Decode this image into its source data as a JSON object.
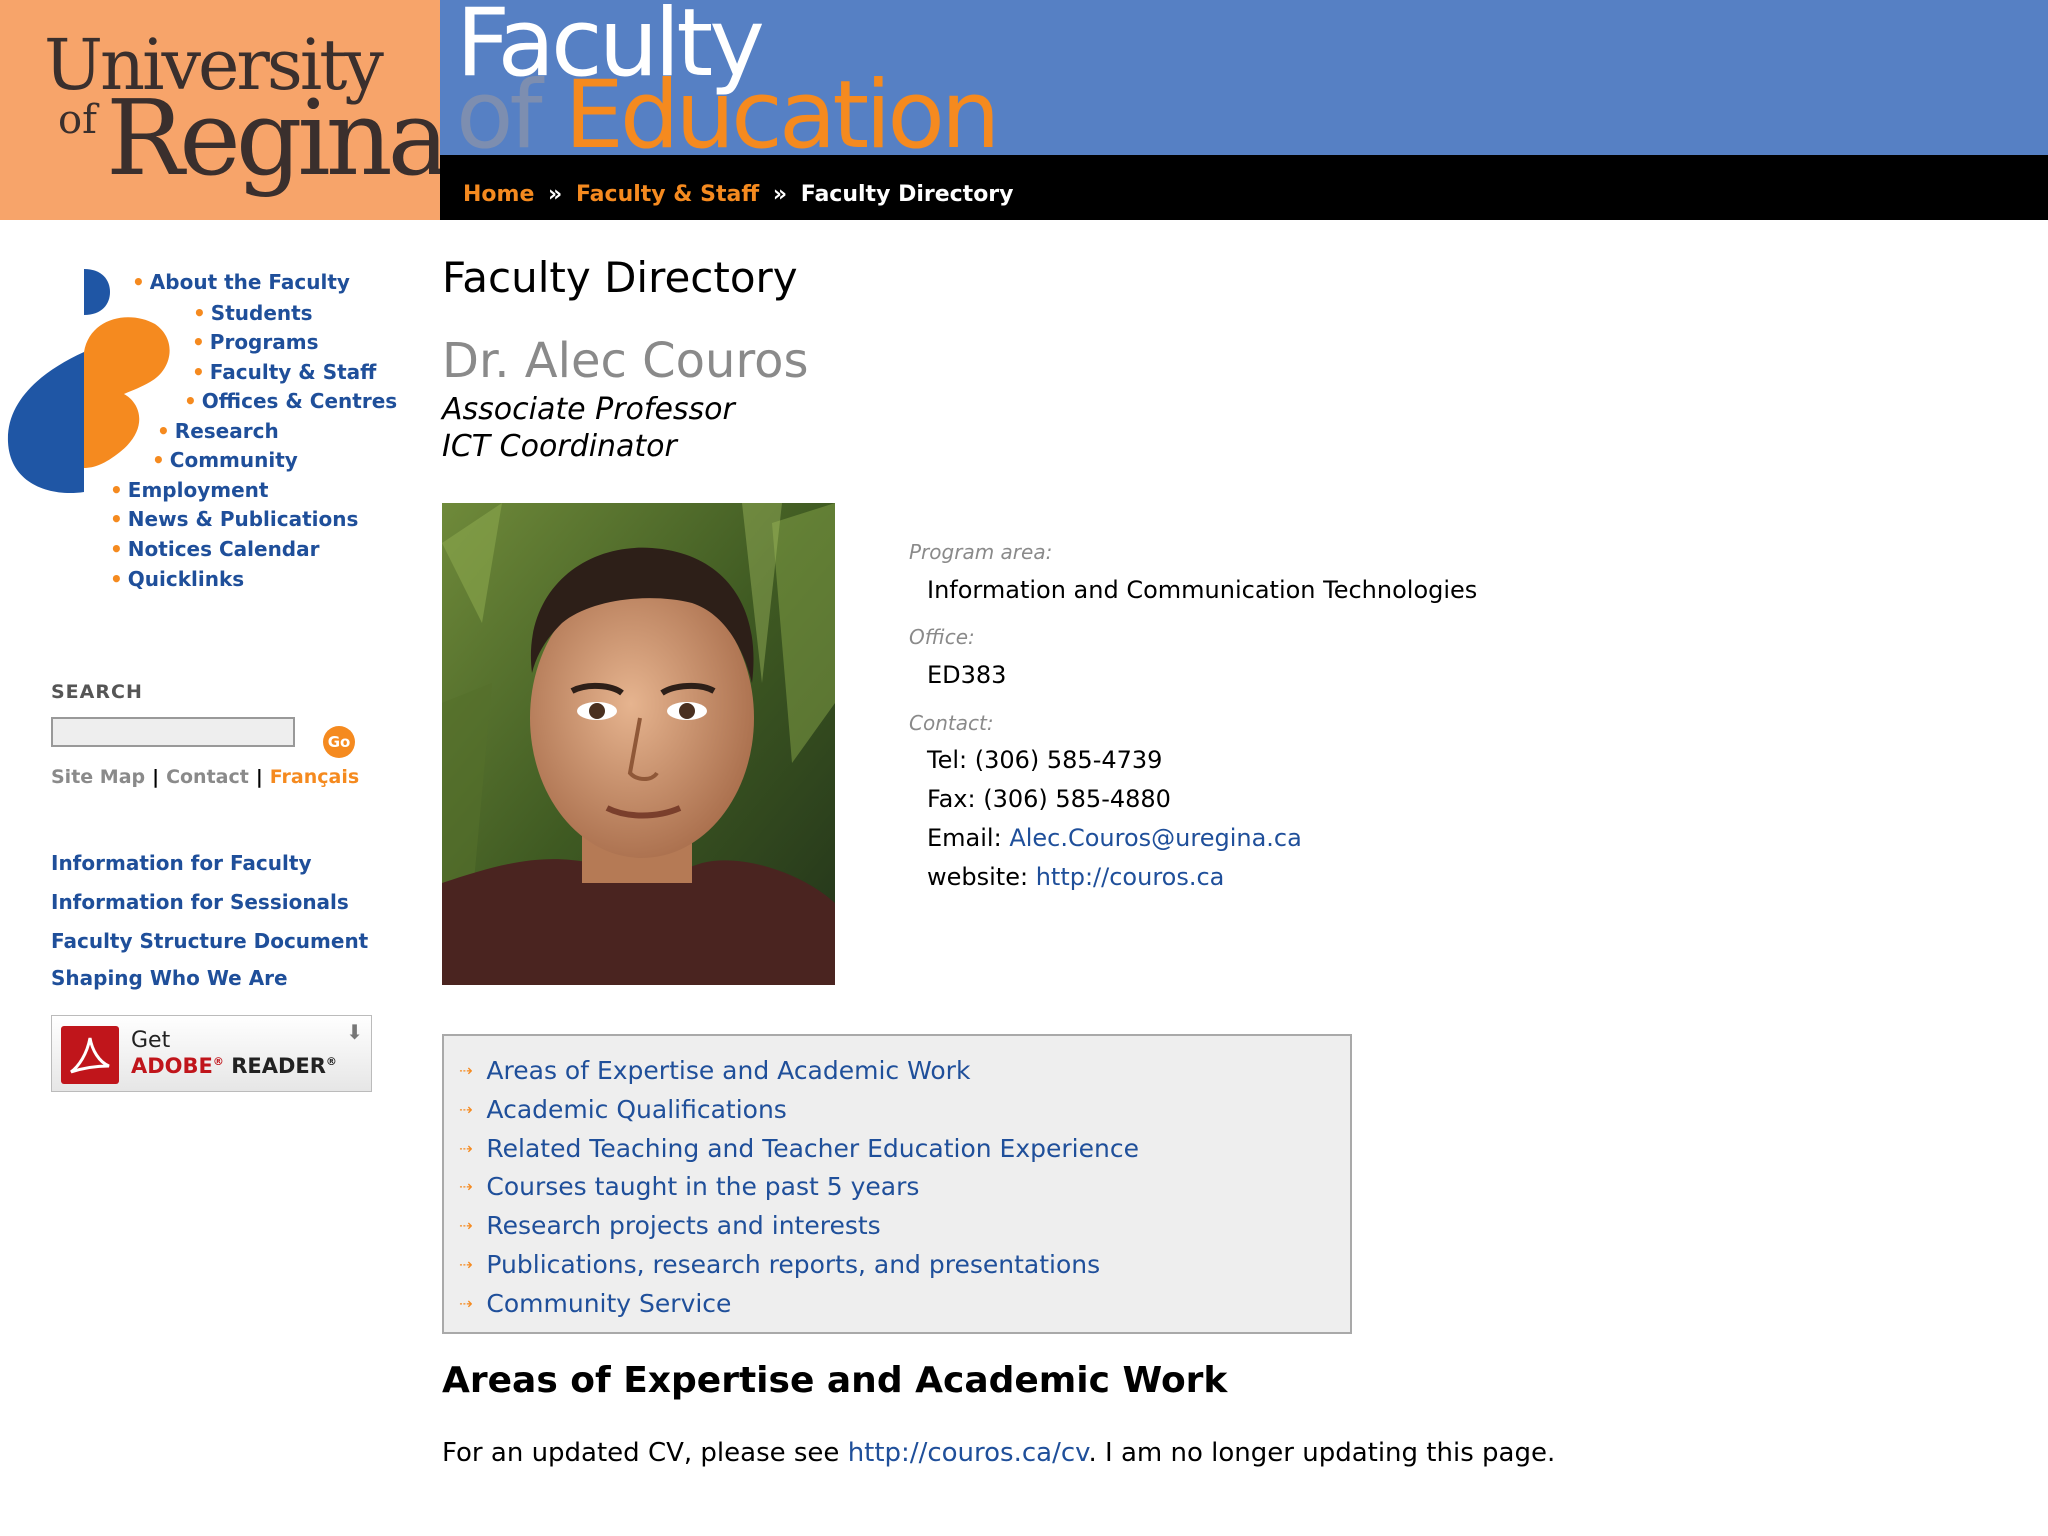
{
  "header": {
    "university_line1": "University",
    "university_of": "of",
    "university_line2": "Regina",
    "faculty_line1": "Faculty",
    "faculty_of": "of",
    "faculty_education": "Education"
  },
  "breadcrumb": {
    "home": "Home",
    "separator": "»",
    "faculty_staff": "Faculty & Staff",
    "current": "Faculty Directory"
  },
  "sidebar": {
    "bullet": "•",
    "nav": [
      "About the Faculty",
      "Students",
      "Programs",
      "Faculty & Staff",
      "Offices & Centres",
      "Research",
      "Community",
      "Employment",
      "News & Publications",
      "Notices Calendar",
      "Quicklinks"
    ],
    "search_label": "SEARCH",
    "search_value": "",
    "go_label": "Go",
    "site_map": "Site Map",
    "contact": "Contact",
    "francais": "Français",
    "bar": "|",
    "info_links": [
      "Information for Faculty",
      "Information for Sessionals",
      "Faculty Structure Document",
      "Shaping Who We Are"
    ],
    "adobe": {
      "get": "Get",
      "adobe": "ADOBE",
      "reg": "®",
      "reader": " READER",
      "arrow": "⬇"
    }
  },
  "main": {
    "page_title": "Faculty Directory",
    "name": "Dr. Alec Couros",
    "roles": [
      "Associate Professor",
      "ICT Coordinator"
    ],
    "program_area_label": "Program area:",
    "program_area": "Information and Communication Technologies",
    "office_label": "Office:",
    "office": "ED383",
    "contact_label": "Contact:",
    "tel": "Tel: (306) 585-4739",
    "fax": "Fax: (306) 585-4880",
    "email_label": "Email: ",
    "email": "Alec.Couros@uregina.ca",
    "website_label": "website: ",
    "website": "http://couros.ca",
    "toc_arrow": "⇢",
    "toc": [
      "Areas of Expertise and Academic Work",
      "Academic Qualifications",
      "Related Teaching and Teacher Education Experience",
      "Courses taught in the past 5 years",
      "Research projects and interests",
      "Publications, research reports, and presentations",
      "Community Service"
    ],
    "section_heading": "Areas of Expertise and Academic Work",
    "cv_text_before": "For an updated CV, please see ",
    "cv_link": "http://couros.ca/cv",
    "cv_text_after": ". I am no longer updating this page."
  },
  "colors": {
    "univ_orange": "#f7a46a",
    "faculty_blue": "#5680c4",
    "accent_orange": "#f58a1f",
    "link_blue": "#1f4f9a",
    "adobe_red": "#c0151b"
  }
}
